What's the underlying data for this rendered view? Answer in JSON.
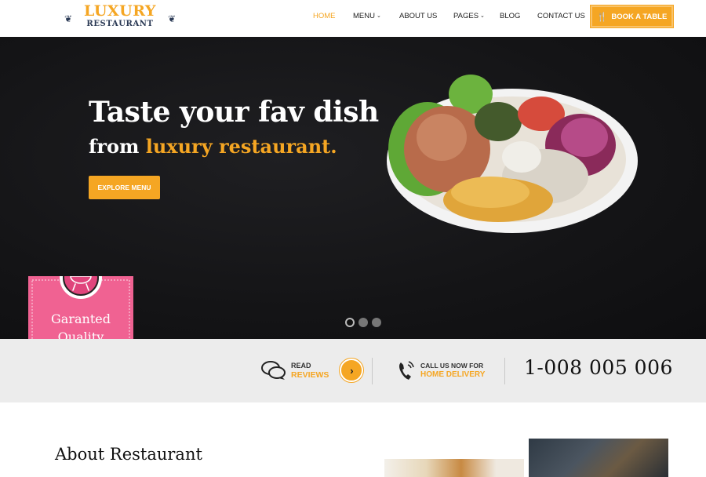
{
  "brand": {
    "line1": "LUXURY",
    "line2": "RESTAURANT",
    "accent": "#f5a623",
    "navy": "#2b3a55"
  },
  "nav": {
    "items": [
      {
        "label": "HOME",
        "active": true
      },
      {
        "label": "MENU",
        "caret": true
      },
      {
        "label": "ABOUT US"
      },
      {
        "label": "PAGES",
        "caret": true
      },
      {
        "label": "BLOG"
      },
      {
        "label": "CONTACT US"
      }
    ],
    "book_button": "BOOK A TABLE",
    "book_icon": "fork-knife-icon"
  },
  "hero": {
    "title_line1": "Taste your fav dish",
    "title_line2_plain": "from ",
    "title_line2_accent": "luxury restaurant.",
    "cta": "EXPLORE MENU",
    "slides": 3,
    "active_slide": 1
  },
  "badge": {
    "line1": "Garanted",
    "line2": "Quality",
    "icon": "grill-icon",
    "color": "#f06292"
  },
  "infobar": {
    "reviews_top": "READ",
    "reviews_bottom": "REVIEWS",
    "reviews_icon": "chat-bubbles-icon",
    "call_top": "CALL US NOW FOR",
    "call_bottom": "HOME DELIVERY",
    "call_icon": "phone-icon",
    "phone": "1-008 005 006"
  },
  "about": {
    "title": "About Restaurant"
  }
}
